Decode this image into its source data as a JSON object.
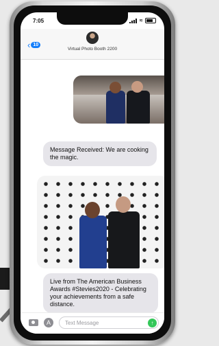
{
  "status": {
    "time": "7:05"
  },
  "header": {
    "back_count": "10",
    "contact_name": "Virtual Photo Booth 2200"
  },
  "messages": [
    {
      "type": "image",
      "description": "photo1"
    },
    {
      "type": "text",
      "text": "Message Received: We are cooking the magic."
    },
    {
      "type": "image",
      "description": "photo2"
    },
    {
      "type": "text",
      "text": "Live from The American Business Awards #Stevies2020 - Celebrating your achievements from a safe distance."
    }
  ],
  "input": {
    "placeholder": "Text Message"
  },
  "icons": {
    "back": "chevron-left-icon",
    "camera": "camera-icon",
    "apps": "app-store-icon",
    "send": "send-arrow-icon"
  },
  "colors": {
    "accent": "#147efb",
    "bubble": "#e6e5ea",
    "send": "#34c759"
  }
}
